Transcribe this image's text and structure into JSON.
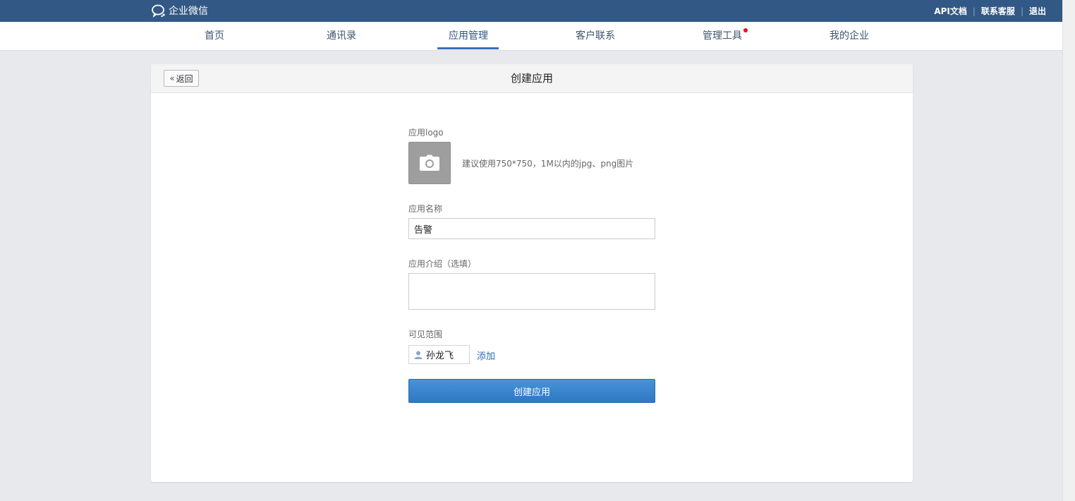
{
  "brand": {
    "name": "企业微信",
    "icon": "wechat-work-logo-icon"
  },
  "top_links": {
    "api_docs": "API文档",
    "contact_support": "联系客服",
    "logout": "退出",
    "separator": "|"
  },
  "nav": {
    "items": [
      {
        "label": "首页"
      },
      {
        "label": "通讯录"
      },
      {
        "label": "应用管理",
        "active": true
      },
      {
        "label": "客户联系"
      },
      {
        "label": "管理工具",
        "badge": "red-dot"
      },
      {
        "label": "我的企业"
      }
    ]
  },
  "page": {
    "back_label": "返回",
    "title": "创建应用"
  },
  "form": {
    "logo_label": "应用logo",
    "logo_hint": "建议使用750*750，1M以内的jpg、png图片",
    "name_label": "应用名称",
    "name_value": "告警",
    "desc_label": "应用介绍（选填）",
    "desc_value": "",
    "scope_label": "可见范围",
    "scope_member": "孙龙飞",
    "add_label": "添加",
    "submit_label": "创建应用"
  },
  "colors": {
    "header_bg": "#325885",
    "accent": "#3871b9",
    "button": "#3582cc",
    "badge": "#e9131f"
  }
}
